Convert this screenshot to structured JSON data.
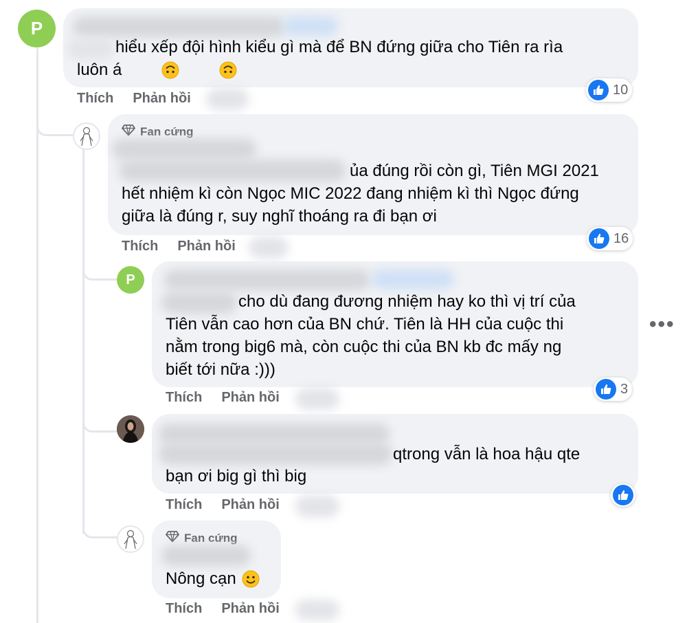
{
  "comments": [
    {
      "avatar_letter": "P",
      "text": "hiểu xếp đội hình kiểu gì mà để BN đứng giữa cho Tiên ra rìa\nluôn á",
      "reaction_count": "10"
    },
    {
      "badge": "Fan cứng",
      "text_line1": "ủa đúng rồi còn gì, Tiên MGI 2021",
      "text_rest": "hết nhiệm kì còn Ngọc MIC 2022 đang nhiệm kì thì Ngọc đứng\ngiữa là đúng r, suy nghĩ thoáng ra đi bạn ơi",
      "reaction_count": "16"
    },
    {
      "avatar_letter": "P",
      "text_line1": "cho dù đang đương nhiệm hay ko thì vị trí của",
      "text_rest": "Tiên vẫn cao hơn của BN chứ. Tiên là HH của cuộc thi\nnằm trong big6 mà, còn cuộc thi của BN kb đc mấy ng\nbiết tới nữa :)))",
      "reaction_count": "3"
    },
    {
      "text_line1": "qtrong vẫn là hoa hậu qte",
      "text_rest": "bạn ơi big gì thì big"
    },
    {
      "badge": "Fan cứng",
      "text": "Nông cạn"
    }
  ],
  "actions": {
    "like": "Thích",
    "reply": "Phản hồi"
  },
  "more_label": "•••",
  "colors": {
    "like_blue": "#1877f2",
    "avatar_green": "#8fce55",
    "bubble": "#f0f2f5",
    "meta_gray": "#65676b"
  }
}
